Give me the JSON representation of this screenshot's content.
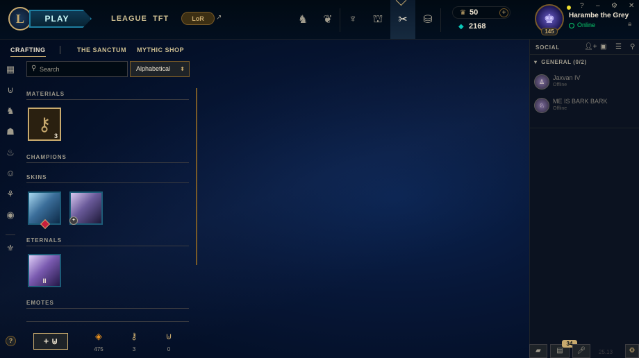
{
  "topbar": {
    "logo": "L",
    "play_label": "PLAY",
    "nav": [
      "LEAGUE",
      "TFT"
    ],
    "lor_label": "LoR",
    "lor_arrow": "↗",
    "icons": [
      "champions-icon",
      "tft-icon",
      "clash-icon",
      "loot-icon",
      "crafting-icon",
      "store-icon"
    ]
  },
  "wallet": {
    "rp_value": "50",
    "rp_add": "+",
    "be_value": "2168"
  },
  "profile": {
    "username": "Harambe the Grey",
    "status": "Online",
    "level": "145"
  },
  "window_controls": [
    "?",
    "–",
    "⚙",
    "✕"
  ],
  "subnav": {
    "tabs": [
      "CRAFTING",
      "THE SANCTUM",
      "MYTHIC SHOP"
    ],
    "active": "CRAFTING"
  },
  "search": {
    "placeholder": "Search",
    "sort_value": "Alphabetical"
  },
  "sections": {
    "materials": "MATERIALS",
    "champions": "CHAMPIONS",
    "skins": "SKINS",
    "eternals": "ETERNALS",
    "emotes": "EMOTES"
  },
  "materials": [
    {
      "name": "key",
      "count": "3"
    }
  ],
  "eternals": [
    {
      "mark": "II"
    }
  ],
  "help_label": "?",
  "bottom": {
    "add_label": "+ ⊍",
    "stats": [
      {
        "icon": "essence-icon",
        "value": "475"
      },
      {
        "icon": "key-fragment-icon",
        "value": "3"
      },
      {
        "icon": "chest-icon",
        "value": "0"
      }
    ]
  },
  "social": {
    "title": "SOCIAL",
    "group": "GENERAL (0/2)",
    "friends": [
      {
        "name": "Jaxvan IV",
        "status": "Offline"
      },
      {
        "name": "ME IS BARK BARK",
        "status": "Offline"
      }
    ],
    "chat_badge": "34",
    "version": "25.13"
  },
  "colors": {
    "gold": "#c8aa6e",
    "background": "#010a13",
    "online": "#0acb6d",
    "blue_essence": "#0ac8b9"
  }
}
